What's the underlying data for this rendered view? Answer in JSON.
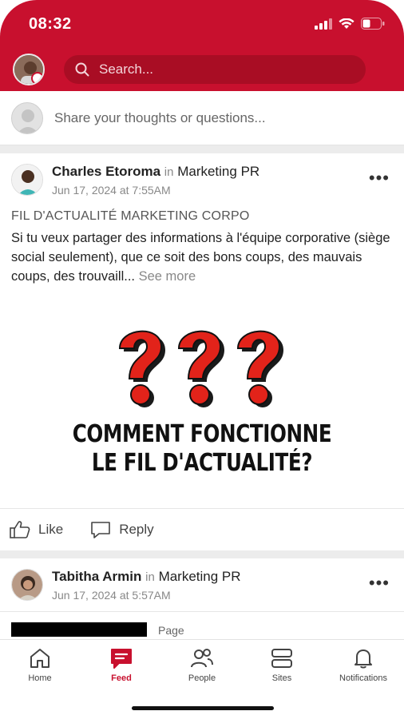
{
  "status_bar": {
    "time": "08:32"
  },
  "header": {
    "search_placeholder": "Search..."
  },
  "composer": {
    "placeholder": "Share your thoughts or questions..."
  },
  "posts": [
    {
      "author": "Charles Etoroma",
      "in_label": "in",
      "group": "Marketing PR",
      "date": "Jun 17, 2024 at 7:55AM",
      "more": "•••",
      "title": "FIL D'ACTUALITÉ MARKETING CORPO",
      "body": "Si tu veux partager des informations à l'équipe corporative (siège social seulement), que ce soit des bons coups, des mauvais coups, des trouvaill...",
      "see_more": "See more",
      "image_text_line1": "COMMENT FONCTIONNE",
      "image_text_line2": "LE FIL D'ACTUALITÉ?",
      "like_label": "Like",
      "reply_label": "Reply"
    },
    {
      "author": "Tabitha Armin",
      "in_label": "in",
      "group": "Marketing PR",
      "date": "Jun 17, 2024 at 5:57AM",
      "more": "•••",
      "page_label": "Page"
    }
  ],
  "bottom_nav": {
    "items": [
      {
        "label": "Home",
        "icon": "home-icon"
      },
      {
        "label": "Feed",
        "icon": "feed-icon",
        "active": true
      },
      {
        "label": "People",
        "icon": "people-icon"
      },
      {
        "label": "Sites",
        "icon": "sites-icon"
      },
      {
        "label": "Notifications",
        "icon": "bell-icon"
      }
    ]
  },
  "colors": {
    "brand": "#c8102e",
    "brand_dark": "#a90d24"
  }
}
